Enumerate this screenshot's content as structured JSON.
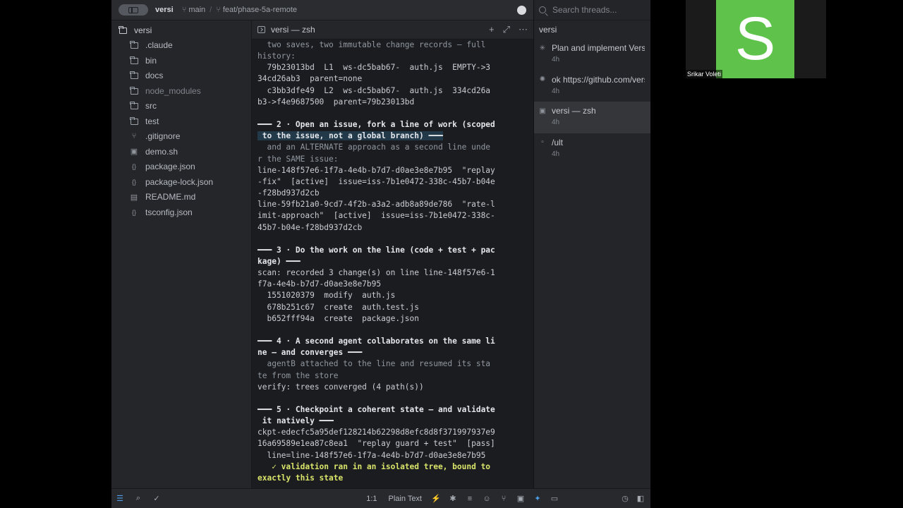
{
  "titlebar": {
    "project": "versi",
    "branch_base": "main",
    "branch_current": "feat/phase-5a-remote"
  },
  "filetree": {
    "root": "versi",
    "items": [
      {
        "name": ".claude",
        "icon": "folder-icon",
        "dim": false
      },
      {
        "name": "bin",
        "icon": "folder-icon",
        "dim": false
      },
      {
        "name": "docs",
        "icon": "folder-icon",
        "dim": false
      },
      {
        "name": "node_modules",
        "icon": "folder-icon",
        "dim": true
      },
      {
        "name": "src",
        "icon": "folder-icon",
        "dim": false
      },
      {
        "name": "test",
        "icon": "folder-icon",
        "dim": false
      },
      {
        "name": ".gitignore",
        "icon": "git-icon",
        "dim": false
      },
      {
        "name": "demo.sh",
        "icon": "shell-script-icon",
        "dim": false
      },
      {
        "name": "package.json",
        "icon": "json-icon",
        "dim": false
      },
      {
        "name": "package-lock.json",
        "icon": "json-icon",
        "dim": false
      },
      {
        "name": "README.md",
        "icon": "markdown-icon",
        "dim": false
      },
      {
        "name": "tsconfig.json",
        "icon": "json-icon",
        "dim": false
      }
    ]
  },
  "terminal": {
    "tab_title": "versi — zsh",
    "lines": [
      {
        "text": "  two saves, two immutable change records — full",
        "cls": "t-dim"
      },
      {
        "text": "history:",
        "cls": "t-dim"
      },
      {
        "text": "  79b23013bd  L1  ws-dc5bab67-  auth.js  EMPTY->3",
        "cls": ""
      },
      {
        "text": "34cd26ab3  parent=none",
        "cls": ""
      },
      {
        "text": "  c3bb3dfe49  L2  ws-dc5bab67-  auth.js  334cd26a",
        "cls": ""
      },
      {
        "text": "b3->f4e9687500  parent=79b23013bd",
        "cls": ""
      },
      {
        "text": "",
        "cls": ""
      },
      {
        "text": "━━━ 2 · Open an issue, fork a line of work (scoped",
        "cls": "t-head"
      },
      {
        "text": " to the issue, not a global branch) ━━━",
        "cls": "t-head t-sel"
      },
      {
        "text": "  and an ALTERNATE approach as a second line unde",
        "cls": "t-dim"
      },
      {
        "text": "r the SAME issue:",
        "cls": "t-dim"
      },
      {
        "text": "line-148f57e6-1f7a-4e4b-b7d7-d0ae3e8e7b95  \"replay",
        "cls": ""
      },
      {
        "text": "-fix\"  [active]  issue=iss-7b1e0472-338c-45b7-b04e",
        "cls": ""
      },
      {
        "text": "-f28bd937d2cb",
        "cls": ""
      },
      {
        "text": "line-59fb21a0-9cd7-4f2b-a3a2-adb8a89de786  \"rate-l",
        "cls": ""
      },
      {
        "text": "imit-approach\"  [active]  issue=iss-7b1e0472-338c-",
        "cls": ""
      },
      {
        "text": "45b7-b04e-f28bd937d2cb",
        "cls": ""
      },
      {
        "text": "",
        "cls": ""
      },
      {
        "text": "━━━ 3 · Do the work on the line (code + test + pac",
        "cls": "t-head"
      },
      {
        "text": "kage) ━━━",
        "cls": "t-head"
      },
      {
        "text": "scan: recorded 3 change(s) on line line-148f57e6-1",
        "cls": ""
      },
      {
        "text": "f7a-4e4b-b7d7-d0ae3e8e7b95",
        "cls": ""
      },
      {
        "text": "  1551020379  modify  auth.js",
        "cls": ""
      },
      {
        "text": "  678b251c67  create  auth.test.js",
        "cls": ""
      },
      {
        "text": "  b652fff94a  create  package.json",
        "cls": ""
      },
      {
        "text": "",
        "cls": ""
      },
      {
        "text": "━━━ 4 · A second agent collaborates on the same li",
        "cls": "t-head"
      },
      {
        "text": "ne — and converges ━━━",
        "cls": "t-head"
      },
      {
        "text": "  agentB attached to the line and resumed its sta",
        "cls": "t-dim"
      },
      {
        "text": "te from the store",
        "cls": "t-dim"
      },
      {
        "text": "verify: trees converged (4 path(s))",
        "cls": ""
      },
      {
        "text": "",
        "cls": ""
      },
      {
        "text": "━━━ 5 · Checkpoint a coherent state — and validate",
        "cls": "t-head"
      },
      {
        "text": " it natively ━━━",
        "cls": "t-head"
      },
      {
        "text": "ckpt-edecfc5a95def128214b62298d8efc8d8f371997937e9",
        "cls": ""
      },
      {
        "text": "16a69589e1ea87c8ea1  \"replay guard + test\"  [pass]",
        "cls": ""
      },
      {
        "text": "  line=line-148f57e6-1f7a-4e4b-b7d7-d0ae3e8e7b95",
        "cls": ""
      },
      {
        "text": "   ✓ validation ran in an isolated tree, bound to",
        "cls": "t-ok"
      },
      {
        "text": "exactly this state",
        "cls": "t-ok"
      }
    ]
  },
  "threads": {
    "search_placeholder": "Search threads...",
    "title": "versi",
    "items": [
      {
        "title": "Plan and implement Versi",
        "time": "4h",
        "icon": "✳",
        "active": false
      },
      {
        "title": "ok https://github.com/versi",
        "time": "4h",
        "icon": "✺",
        "active": false
      },
      {
        "title": "versi — zsh",
        "time": "4h",
        "icon": "▣",
        "active": true
      },
      {
        "title": "/ult",
        "time": "4h",
        "icon": "▫",
        "active": false
      }
    ]
  },
  "statusbar": {
    "cursor_position": "1:1",
    "language_mode": "Plain Text"
  },
  "video": {
    "initial": "S",
    "participant_name": "Srikar Voleti",
    "avatar_color": "#5fc24b"
  }
}
